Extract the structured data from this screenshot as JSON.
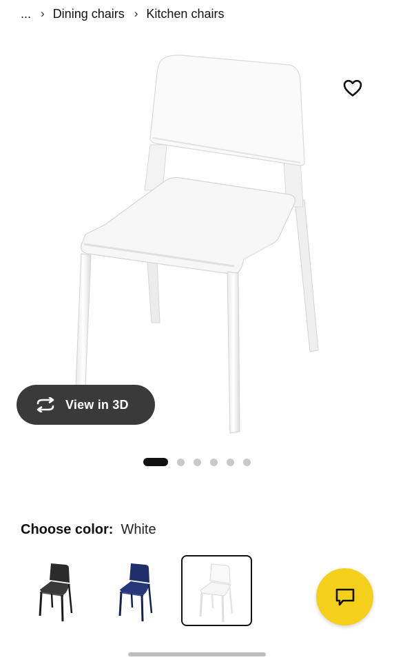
{
  "breadcrumb": {
    "ellipsis": "...",
    "separator": "›",
    "items": [
      {
        "label": "Dining chairs"
      },
      {
        "label": "Kitchen chairs"
      }
    ]
  },
  "product": {
    "favorite_icon": "heart-outline-icon",
    "view3d_icon": "rotate-3d-icon",
    "view3d_label": "View in 3D",
    "carousel": {
      "total": 6,
      "active_index": 0
    }
  },
  "color": {
    "title": "Choose color:",
    "selected": "White",
    "options": [
      {
        "name": "Black",
        "hex": "#2b2b2b",
        "selected": false
      },
      {
        "name": "Blue",
        "hex": "#1f2f6b",
        "selected": false
      },
      {
        "name": "White",
        "hex": "#ffffff",
        "selected": true
      }
    ]
  },
  "chat": {
    "icon": "chat-bubble-icon",
    "color": "#f4d01c"
  },
  "colors": {
    "view3d_bg": "#3a3a3a",
    "accent_yellow": "#f4d01c"
  }
}
